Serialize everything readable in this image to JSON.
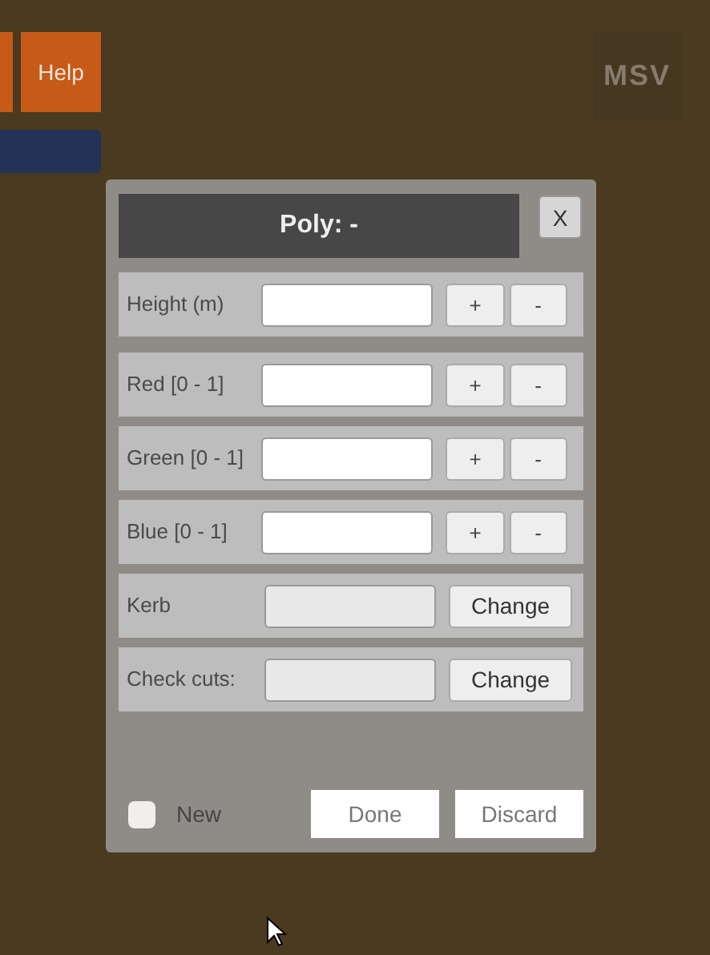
{
  "toolbar": {
    "help_label": "Help"
  },
  "logo": {
    "text": "MSV"
  },
  "dialog": {
    "title": "Poly: -",
    "close_label": "X",
    "rows": [
      {
        "kind": "stepper",
        "label": "Height (m)",
        "disabled": false,
        "plus": "+",
        "minus": "-"
      },
      {
        "kind": "stepper",
        "label": "Red [0 - 1]",
        "disabled": false,
        "plus": "+",
        "minus": "-"
      },
      {
        "kind": "stepper",
        "label": "Green [0 - 1]",
        "disabled": false,
        "plus": "+",
        "minus": "-"
      },
      {
        "kind": "stepper",
        "label": "Blue [0 - 1]",
        "disabled": false,
        "plus": "+",
        "minus": "-"
      },
      {
        "kind": "change",
        "label": "Kerb",
        "disabled": true,
        "button": "Change"
      },
      {
        "kind": "change",
        "label": "Check cuts:",
        "disabled": true,
        "button": "Change"
      }
    ],
    "new_checkbox": {
      "label": "New",
      "checked": false
    },
    "buttons": [
      "Done",
      "Discard"
    ]
  }
}
